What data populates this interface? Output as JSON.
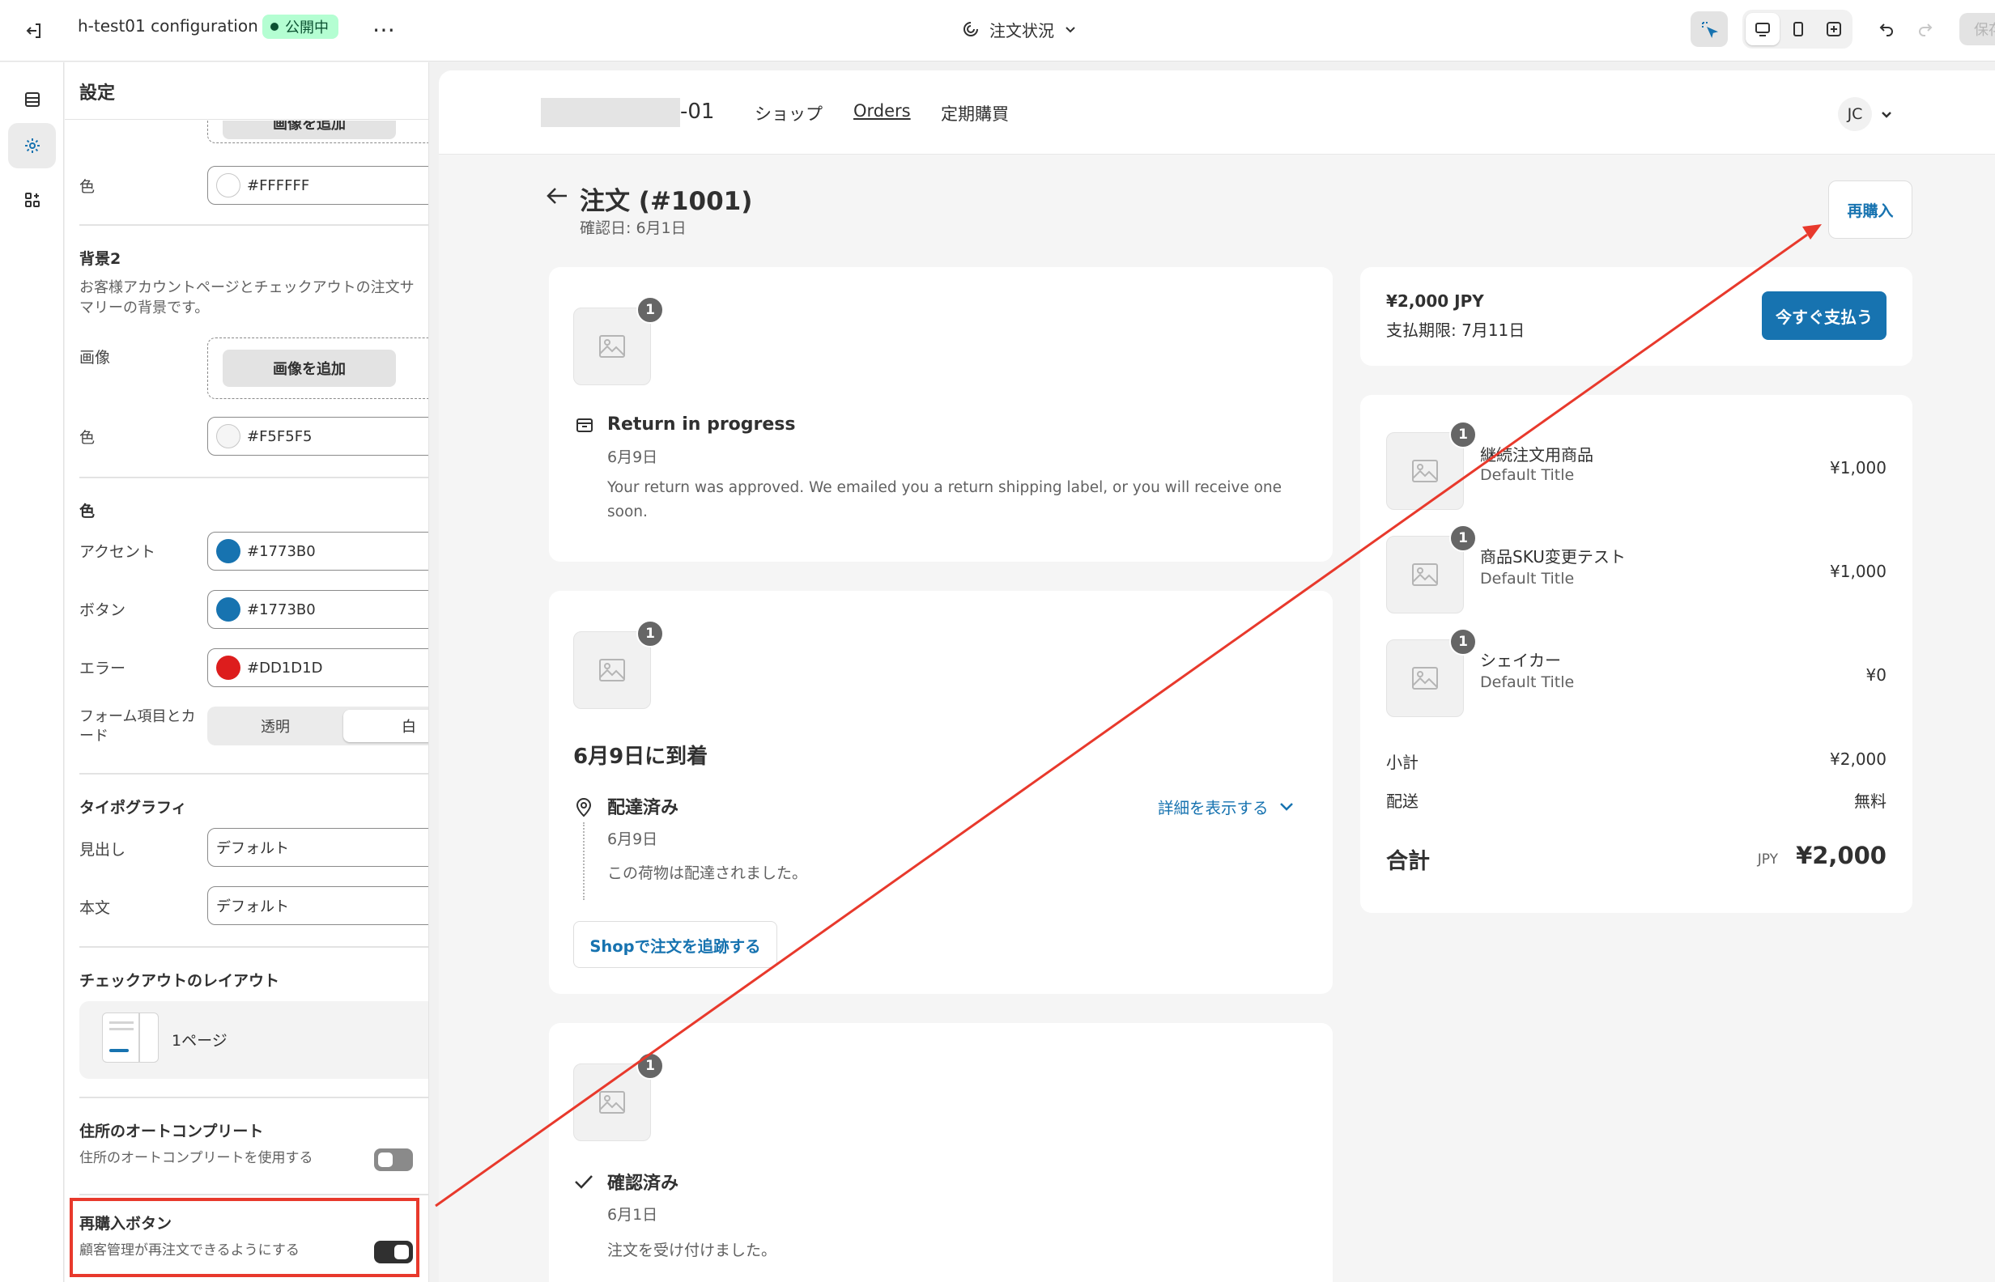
{
  "topbar": {
    "store_name": "h-test01 configuration",
    "status_badge": "公開中",
    "page_selector": "注文状況",
    "save_label": "保存"
  },
  "panel": {
    "title": "設定",
    "clipped_button": "画像を追加",
    "bg1_color_label": "色",
    "bg1_color_value": "#FFFFFF",
    "bg2_title": "背景2",
    "bg2_desc_line1": "お客様アカウントページとチェックアウトの注文サ",
    "bg2_desc_line2": "マリーの背景です。",
    "image_label": "画像",
    "add_image": "画像を追加",
    "bg2_color_label": "色",
    "bg2_color_value": "#F5F5F5",
    "colors_title": "色",
    "accent_label": "アクセント",
    "accent_value": "#1773B0",
    "button_label": "ボタン",
    "button_value": "#1773B0",
    "error_label": "エラー",
    "error_value": "#DD1D1D",
    "form_label_line1": "フォーム項目とカ",
    "form_label_line2": "ード",
    "seg_transparent": "透明",
    "seg_white": "白",
    "typo_title": "タイポグラフィ",
    "heading_label": "見出し",
    "heading_value": "デフォルト",
    "body_label": "本文",
    "body_value": "デフォルト",
    "layout_title": "チェックアウトのレイアウト",
    "layout_value": "1ページ",
    "autocomplete_title": "住所のオートコンプリート",
    "autocomplete_desc": "住所のオートコンプリートを使用する",
    "reorder_title": "再購入ボタン",
    "reorder_desc": "顧客管理が再注文できるようにする"
  },
  "colors": {
    "accent": "#1773B0",
    "error": "#DD1D1D",
    "bg1": "#FFFFFF",
    "bg2": "#F5F5F5",
    "annotation": "#E8392C"
  },
  "preview": {
    "store_suffix": "-01",
    "nav": [
      "ショップ",
      "Orders",
      "定期購買"
    ],
    "avatar": "JC",
    "order_title": "注文 (#1001)",
    "confirmed_date": "確認日: 6月1日",
    "reorder_button": "再購入",
    "return_card": {
      "qty": "1",
      "title": "Return in progress",
      "date": "6月9日",
      "text_line1": "Your return was approved. We emailed you a return shipping label, or you will receive one",
      "text_line2": "soon."
    },
    "delivery_card": {
      "qty": "1",
      "heading": "6月9日に到着",
      "status": "配達済み",
      "details_link": "詳細を表示する",
      "date": "6月9日",
      "text": "この荷物は配達されました。",
      "track_button": "Shopで注文を追跡する"
    },
    "confirmed_card": {
      "qty": "1",
      "status": "確認済み",
      "date": "6月1日",
      "text": "注文を受け付けました。"
    },
    "payment_card": {
      "amount": "¥2,000 JPY",
      "due": "支払期限: 7月11日",
      "pay_button": "今すぐ支払う"
    },
    "summary": {
      "items": [
        {
          "qty": "1",
          "name": "継続注文用商品",
          "variant": "Default Title",
          "price": "¥1,000"
        },
        {
          "qty": "1",
          "name": "商品SKU変更テスト",
          "variant": "Default Title",
          "price": "¥1,000"
        },
        {
          "qty": "1",
          "name": "シェイカー",
          "variant": "Default Title",
          "price": "¥0"
        }
      ],
      "subtotal_label": "小計",
      "subtotal_value": "¥2,000",
      "shipping_label": "配送",
      "shipping_value": "無料",
      "total_label": "合計",
      "total_currency": "JPY",
      "total_value": "¥2,000"
    }
  }
}
